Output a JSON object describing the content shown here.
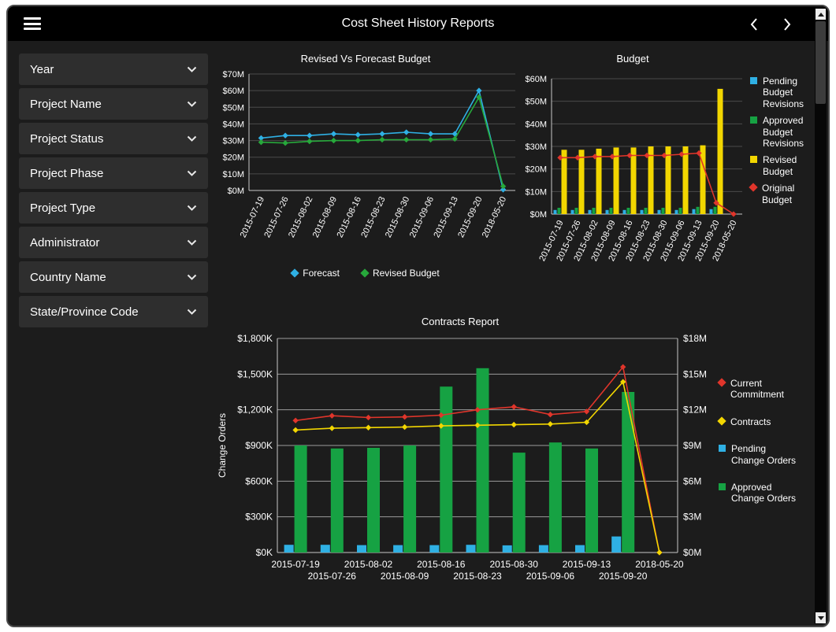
{
  "header": {
    "title": "Cost Sheet History Reports",
    "menu_icon": "hamburger-menu",
    "prev_icon": "chevron-left",
    "next_icon": "chevron-right"
  },
  "sidebar": {
    "dropdown_icon": "chevron-down",
    "items": [
      {
        "label": "Year"
      },
      {
        "label": "Project Name"
      },
      {
        "label": "Project Status"
      },
      {
        "label": "Project Phase"
      },
      {
        "label": "Project Type"
      },
      {
        "label": "Administrator"
      },
      {
        "label": "Country Name"
      },
      {
        "label": "State/Province Code"
      }
    ]
  },
  "colors": {
    "background": "#1c1c1c",
    "titlebar": "#000000",
    "panel": "#2e2e2e",
    "blue": "#2fb0e4",
    "green_line": "#27a83b",
    "green_bar": "#16a243",
    "yellow": "#f2d600",
    "red": "#e0352b"
  },
  "chart_data": [
    {
      "id": "revised-vs-forecast",
      "type": "line",
      "title": "Revised Vs Forecast Budget",
      "categories": [
        "2015-07-19",
        "2015-07-26",
        "2015-08-02",
        "2015-08-09",
        "2015-08-16",
        "2015-08-23",
        "2015-08-30",
        "2015-09-06",
        "2015-09-13",
        "2015-09-20",
        "2018-05-20"
      ],
      "line_series": [
        {
          "name": "Forecast",
          "color": "#2fb0e4",
          "values": [
            31.5,
            33,
            33,
            34,
            33.5,
            34,
            35,
            34,
            34,
            60,
            0.5
          ]
        },
        {
          "name": "Revised Budget",
          "color": "#27a83b",
          "values": [
            29,
            28.5,
            29.5,
            30,
            30,
            30.5,
            30.5,
            30.5,
            31,
            56,
            2.5
          ]
        }
      ],
      "y_axis": {
        "min": 0,
        "max": 70,
        "ticks": [
          0,
          10,
          20,
          30,
          40,
          50,
          60,
          70
        ],
        "format": {
          "prefix": "$",
          "suffix": "M"
        }
      },
      "legend_position": "bottom",
      "grid": true
    },
    {
      "id": "budget",
      "type": "bar",
      "title": "Budget",
      "categories": [
        "2015-07-19",
        "2015-07-26",
        "2015-08-02",
        "2015-08-09",
        "2015-08-16",
        "2015-08-23",
        "2015-08-30",
        "2015-09-06",
        "2015-09-13",
        "2015-09-20",
        "2018-05-20"
      ],
      "bar_series": [
        {
          "name": "Pending Budget Revisions",
          "color": "#2fb0e4",
          "values": [
            1.8,
            1.8,
            1.8,
            1.8,
            1.8,
            1.8,
            1.8,
            1.8,
            2.2,
            2.2,
            0
          ]
        },
        {
          "name": "Approved Budget Revisions",
          "color": "#16a243",
          "values": [
            2.8,
            2.8,
            2.8,
            2.8,
            2.8,
            2.8,
            2.8,
            2.8,
            3.2,
            3.2,
            0
          ]
        },
        {
          "name": "Revised Budget",
          "color": "#f2d600",
          "values": [
            28.5,
            28.5,
            29,
            29.5,
            29.5,
            30,
            30,
            30,
            30.5,
            55.5,
            0
          ]
        }
      ],
      "line_series": [
        {
          "name": "Original Budget",
          "color": "#e0352b",
          "values": [
            25,
            25,
            25.5,
            25.5,
            26,
            26,
            26,
            26.5,
            27,
            5,
            0
          ]
        }
      ],
      "y_axis": {
        "min": 0,
        "max": 60,
        "ticks": [
          0,
          10,
          20,
          30,
          40,
          50,
          60
        ],
        "format": {
          "prefix": "$",
          "suffix": "M"
        }
      },
      "legend_position": "right",
      "grid": true
    },
    {
      "id": "contracts-report",
      "type": "bar",
      "title": "Contracts Report",
      "ylabel": "Change Orders",
      "categories": [
        "2015-07-19",
        "2015-07-26",
        "2015-08-02",
        "2015-08-09",
        "2015-08-16",
        "2015-08-23",
        "2015-08-30",
        "2015-09-06",
        "2015-09-13",
        "2015-09-20",
        "2018-05-20"
      ],
      "bar_series": [
        {
          "name": "Pending Change Orders",
          "color": "#2fb0e4",
          "values": [
            65,
            65,
            62,
            62,
            62,
            65,
            60,
            62,
            62,
            135,
            0
          ]
        },
        {
          "name": "Approved Change Orders",
          "color": "#16a243",
          "values": [
            900,
            875,
            880,
            900,
            1395,
            1550,
            840,
            925,
            875,
            1350,
            0
          ]
        }
      ],
      "line_series": [
        {
          "name": "Current Commitment",
          "color": "#e0352b",
          "axis": "right",
          "values": [
            11.1,
            11.5,
            11.35,
            11.4,
            11.55,
            12.0,
            12.25,
            11.6,
            11.85,
            15.6,
            0
          ]
        },
        {
          "name": "Contracts",
          "color": "#f2d600",
          "axis": "right",
          "values": [
            10.3,
            10.45,
            10.5,
            10.55,
            10.65,
            10.7,
            10.75,
            10.8,
            10.95,
            14.35,
            0
          ]
        }
      ],
      "y_axis": {
        "min": 0,
        "max": 1800,
        "ticks": [
          0,
          300,
          600,
          900,
          1200,
          1500,
          1800
        ],
        "format": {
          "prefix": "$",
          "suffix": "K"
        }
      },
      "y2_axis": {
        "min": 0,
        "max": 18,
        "ticks": [
          0,
          3,
          6,
          9,
          12,
          15,
          18
        ],
        "format": {
          "prefix": "$",
          "suffix": "M"
        }
      },
      "legend_position": "right",
      "legend_order": "lines-first",
      "grid": true
    }
  ]
}
